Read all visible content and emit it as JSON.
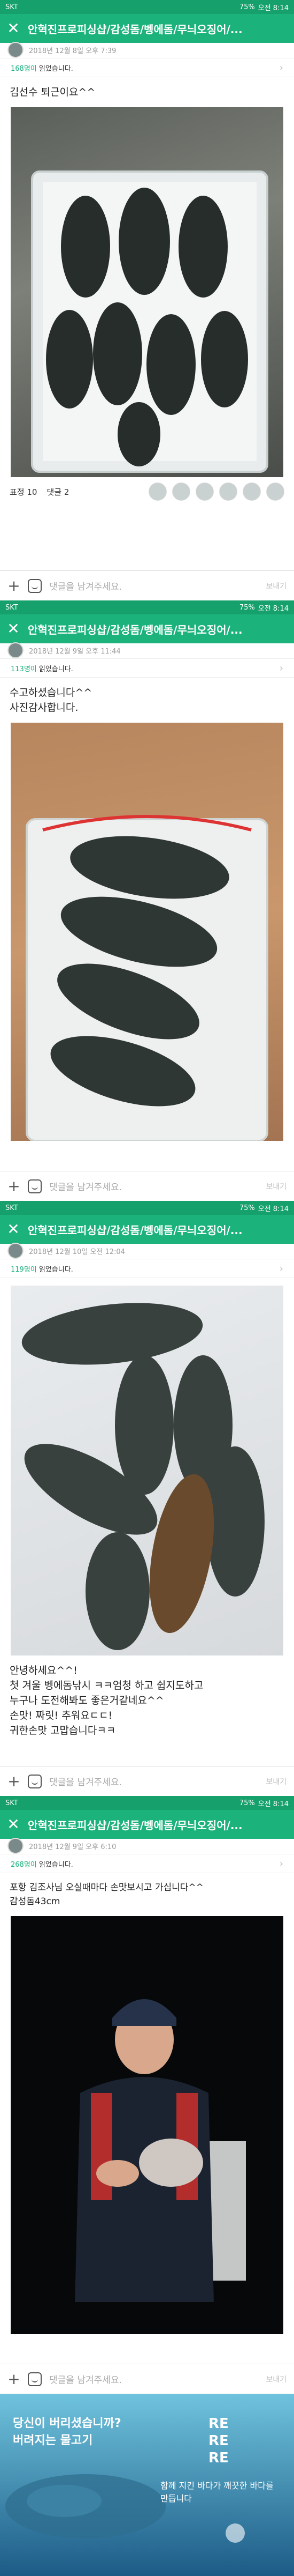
{
  "status": {
    "carrier": "SKT",
    "battery": "75%",
    "time": "오전 8:14"
  },
  "app": {
    "title": "안혁진프로피싱샵/감성돔/벵에돔/무늬오징어/..."
  },
  "posts": [
    {
      "date": "2018년 12월 8일 오후 7:39",
      "read_count": "168명이",
      "read_suffix": " 읽었습니다.",
      "text": [
        "김선수 퇴근이요^^"
      ],
      "likes": "표정 10",
      "comments": "댓글 2"
    },
    {
      "date": "2018년 12월 9일 오후 11:44",
      "read_count": "113명이",
      "read_suffix": " 읽었습니다.",
      "text": [
        "수고하셨습니다^^",
        "사진감사합니다."
      ]
    },
    {
      "date": "2018년 12월 10일 오전 12:04",
      "read_count": "119명이",
      "read_suffix": " 읽었습니다.",
      "text": [
        "안녕하세요^^!",
        "첫 겨울 벵에돔낚시 ㅋㅋ엄청 하고 쉽지도하고",
        "누구나 도전해봐도 좋은거같네요^^",
        "손맛! 짜릿! 추워요ㄷㄷ!",
        "귀한손맛 고맙습니다ㅋㅋ"
      ]
    },
    {
      "date": "2018년 12월 9일 오후 6:10",
      "read_count": "268명이",
      "read_suffix": " 읽었습니다.",
      "text": [
        "포항 김조사님 오실때마다 손맛보시고 가십니다^^",
        "감성돔43cm"
      ]
    }
  ],
  "comment": {
    "placeholder": "댓글을 남겨주세요.",
    "send": "보내기"
  },
  "ad": {
    "line1": "당신이 버리셨습니까?",
    "line2": "버려지는 물고기",
    "tag1": "RE",
    "tag2": "RE",
    "tag3": "RE",
    "slogan": "함께 지킨 바다가 깨끗한 바다를 만듭니다"
  }
}
